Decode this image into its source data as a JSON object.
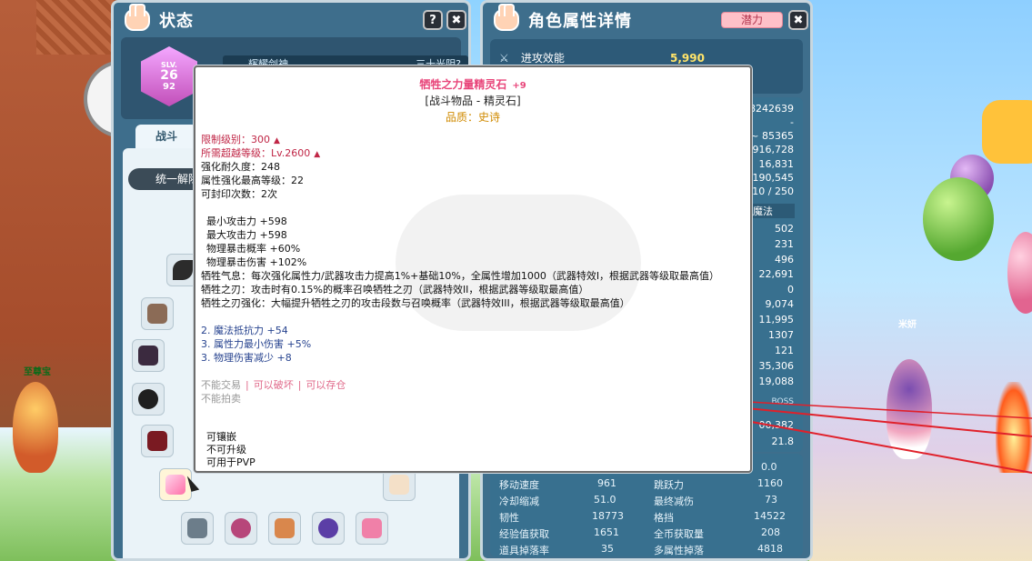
{
  "status_window": {
    "title": "状态",
    "help_label": "?",
    "close_label": "✖",
    "level": {
      "slv": "SLV.",
      "value": "26",
      "sub": "92"
    },
    "job_label": "辉耀剑神",
    "job_right": "三十光阴?",
    "tab_fight": "战斗",
    "unify_label": "统一解除"
  },
  "detail_window": {
    "title": "角色属性详情",
    "potential_tab": "潜力",
    "close_label": "✖",
    "attack_label": "进攻效能",
    "attack_value": "5,990",
    "right_values": [
      "8242639",
      "-",
      "~ 85365",
      "916,728",
      "16,831",
      "190,545",
      "10 / 250"
    ],
    "magic_header": "魔法",
    "magic_values": [
      "502",
      "231",
      "496",
      "22,691",
      "0",
      "9,074",
      "11,995",
      "1307",
      "121",
      "35,306",
      "19,088"
    ],
    "boss_label": "BOSS",
    "boss_values": [
      "00,382",
      "21.8"
    ],
    "stats": [
      {
        "left_label": "",
        "left_value": "",
        "right_label": "",
        "right_value": "0.0"
      },
      {
        "left_label": "移动速度",
        "left_value": "961",
        "right_label": "跳跃力",
        "right_value": "1160"
      },
      {
        "left_label": "冷却缩减",
        "left_value": "51.0",
        "right_label": "最终减伤",
        "right_value": "73"
      },
      {
        "left_label": "韧性",
        "left_value": "18773",
        "right_label": "格挡",
        "right_value": "14522"
      },
      {
        "left_label": "经验值获取",
        "left_value": "1651",
        "right_label": "全币获取量",
        "right_value": "208"
      },
      {
        "left_label": "道具掉落率",
        "left_value": "35",
        "right_label": "多属性掉落",
        "right_value": "4818"
      }
    ]
  },
  "tooltip": {
    "name": "牺牲之力量精灵石",
    "enhance": "+9",
    "type": "[战斗物品 - 精灵石]",
    "quality": "品质：史诗",
    "req_level": "限制级别：300",
    "req_transcend": "所需超越等级：Lv.2600",
    "durability": "强化耐久度：248",
    "attr_max": "属性强化最高等级：22",
    "seal_count": "可封印次数：2次",
    "base_stats": [
      "最小攻击力 +598",
      "最大攻击力 +598",
      "物理暴击概率 +60%",
      "物理暴击伤害 +102%"
    ],
    "effects": [
      "牺牲气息：每次强化属性力/武器攻击力提高1%+基础10%，全属性增加1000（武器特效I，根据武器等级取最高值）",
      "牺牲之刃：攻击时有0.15%的概率召唤牺牲之刃（武器特效II，根据武器等级取最高值）",
      "牺牲之刃强化：大幅提升牺牲之刃的攻击段数与召唤概率（武器特效III，根据武器等级取最高值）"
    ],
    "random_stats": [
      "2. 魔法抵抗力 +54",
      "3. 属性力最小伤害 +5%",
      "3. 物理伤害减少 +8"
    ],
    "trade_no": "不能交易",
    "trade_break": "可以破坏",
    "trade_store": "可以存仓",
    "auction_no": "不能拍卖",
    "socket": "可镶嵌",
    "no_upgrade": "不可升级",
    "pvp": "可用于PVP"
  },
  "scene": {
    "npc_left_name": "至尊宝",
    "npc_right_name": "米妍"
  },
  "colors": {
    "window_bg": "#3e6e8c",
    "tooltip_name": "#e8457a",
    "quality": "#d08a00",
    "requirement": "#c02646",
    "random_stat": "#27438f",
    "attack_value": "#ffe46a"
  }
}
